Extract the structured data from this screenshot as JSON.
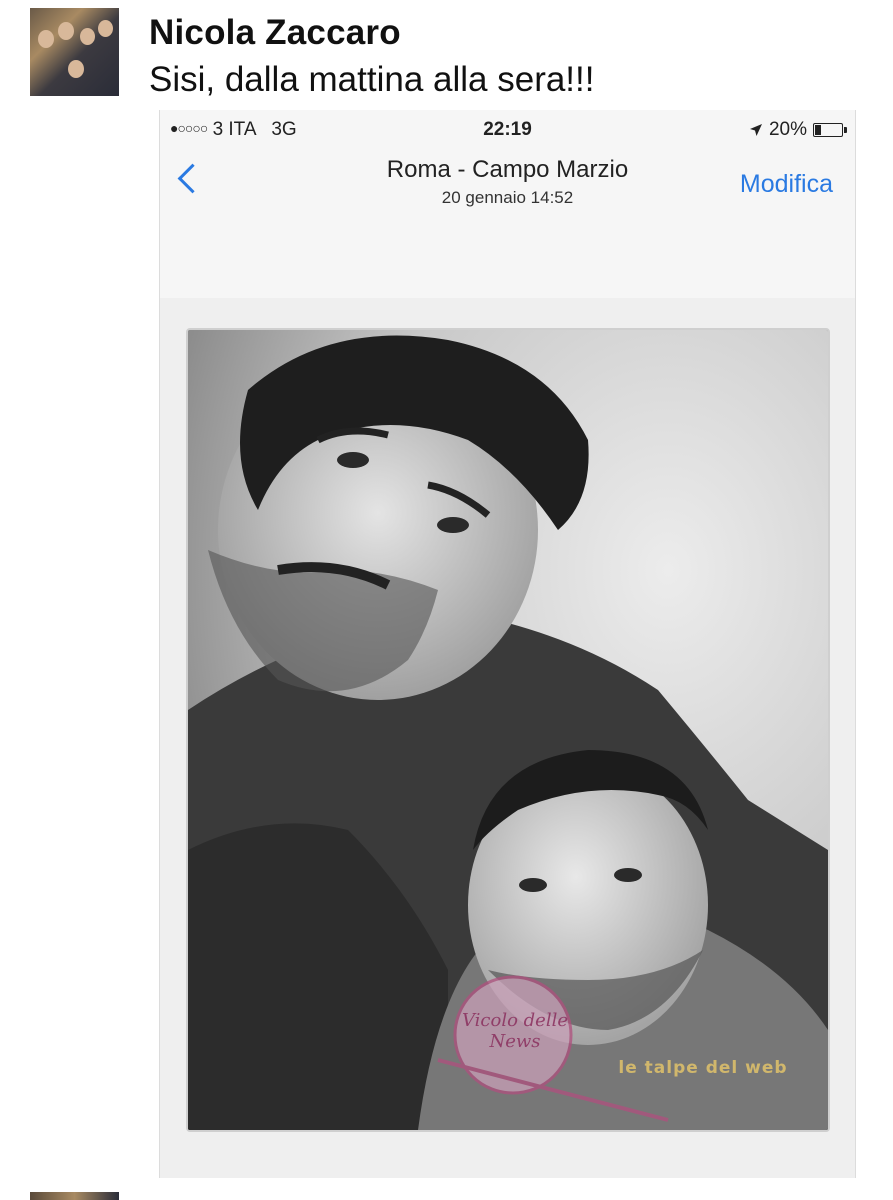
{
  "post": {
    "author": "Nicola Zaccaro",
    "message": "Sisi, dalla mattina alla sera!!!"
  },
  "phone": {
    "status": {
      "signal": "●○○○○",
      "carrier": "3 ITA",
      "network": "3G",
      "time": "22:19",
      "battery": "20%"
    },
    "nav": {
      "title": "Roma - Campo Marzio",
      "subtitle": "20 gennaio  14:52",
      "edit_label": "Modifica"
    }
  },
  "watermarks": {
    "left": "Vicolo delle News",
    "right": "le talpe del web"
  },
  "colors": {
    "ios_blue": "#2a7ae2"
  }
}
